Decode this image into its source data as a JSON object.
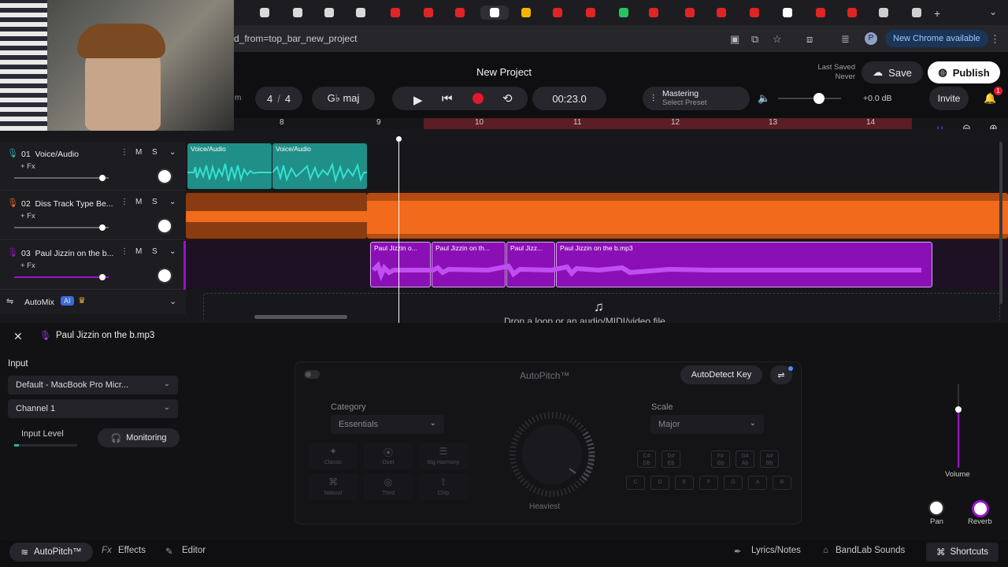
{
  "browser": {
    "url_fragment": "d_from=top_bar_new_project",
    "new_chrome_label": "New Chrome available",
    "profile_initial": "P"
  },
  "header": {
    "project_title": "New Project",
    "last_saved_label": "Last Saved",
    "last_saved_value": "Never",
    "save_label": "Save",
    "publish_label": "Publish",
    "time_signature_num": "4",
    "time_signature_sep": "/",
    "time_signature_den": "4",
    "key": "G♭ maj",
    "time_display": "00:23.0",
    "mastering_label": "Mastering",
    "mastering_sub": "Select Preset",
    "volume_db": "+0.0 dB",
    "invite_label": "Invite",
    "notif_count": "1",
    "zoom_partial": "m"
  },
  "ruler": {
    "bars": [
      "8",
      "9",
      "10",
      "11",
      "12",
      "13",
      "14"
    ]
  },
  "tracks": [
    {
      "num": "01",
      "name": "Voice/Audio",
      "fx": "+ Fx",
      "m": "M",
      "s": "S",
      "color": "#27b5a8"
    },
    {
      "num": "02",
      "name": "Diss Track Type Be...",
      "fx": "+ Fx",
      "m": "M",
      "s": "S",
      "color": "#f26a1b"
    },
    {
      "num": "03",
      "name": "Paul Jizzin on the b...",
      "fx": "+ Fx",
      "m": "M",
      "s": "S",
      "color": "#9b12c9"
    }
  ],
  "clips": {
    "voice": [
      "Voice/Audio",
      "Voice/Audio"
    ],
    "paul": [
      "Paul Jizzin o...",
      "Paul Jizzin on th...",
      "Paul Jizz...",
      "Paul Jizzin on the b.mp3"
    ]
  },
  "automix": {
    "label": "AutoMix",
    "badge": "AI"
  },
  "drop_zone_text": "Drop a loop or an audio/MIDI/video file",
  "editor": {
    "clip_title": "Paul Jizzin on the b.mp3",
    "input_label": "Input",
    "input_device": "Default - MacBook Pro Micr...",
    "channel": "Channel 1",
    "input_level_label": "Input Level",
    "monitoring_label": "Monitoring",
    "autopitch_title": "AutoPitch™",
    "autodetect_label": "AutoDetect Key",
    "category_label": "Category",
    "category_value": "Essentials",
    "scale_label": "Scale",
    "scale_value": "Major",
    "knob_label": "Heaviest",
    "presets": [
      "Classic",
      "Duet",
      "Big Harmony",
      "Natural",
      "Third",
      "Chip"
    ],
    "sharp_keys": [
      "C#\nDb",
      "D#\nEb",
      "F#\nGb",
      "G#\nAb",
      "A#\nBb"
    ],
    "keys": [
      "C",
      "D",
      "E",
      "F",
      "G",
      "A",
      "B"
    ],
    "volume_label": "Volume",
    "pan_label": "Pan",
    "reverb_label": "Reverb"
  },
  "bottom_bar": {
    "autopitch": "AutoPitch™",
    "effects": "Effects",
    "editor": "Editor",
    "lyrics": "Lyrics/Notes",
    "sounds": "BandLab Sounds",
    "shortcuts": "Shortcuts"
  },
  "colors": {
    "accent_teal": "#27b5a8",
    "accent_orange": "#f26a1b",
    "accent_purple": "#9b12c9",
    "record_red": "#e2192e"
  }
}
